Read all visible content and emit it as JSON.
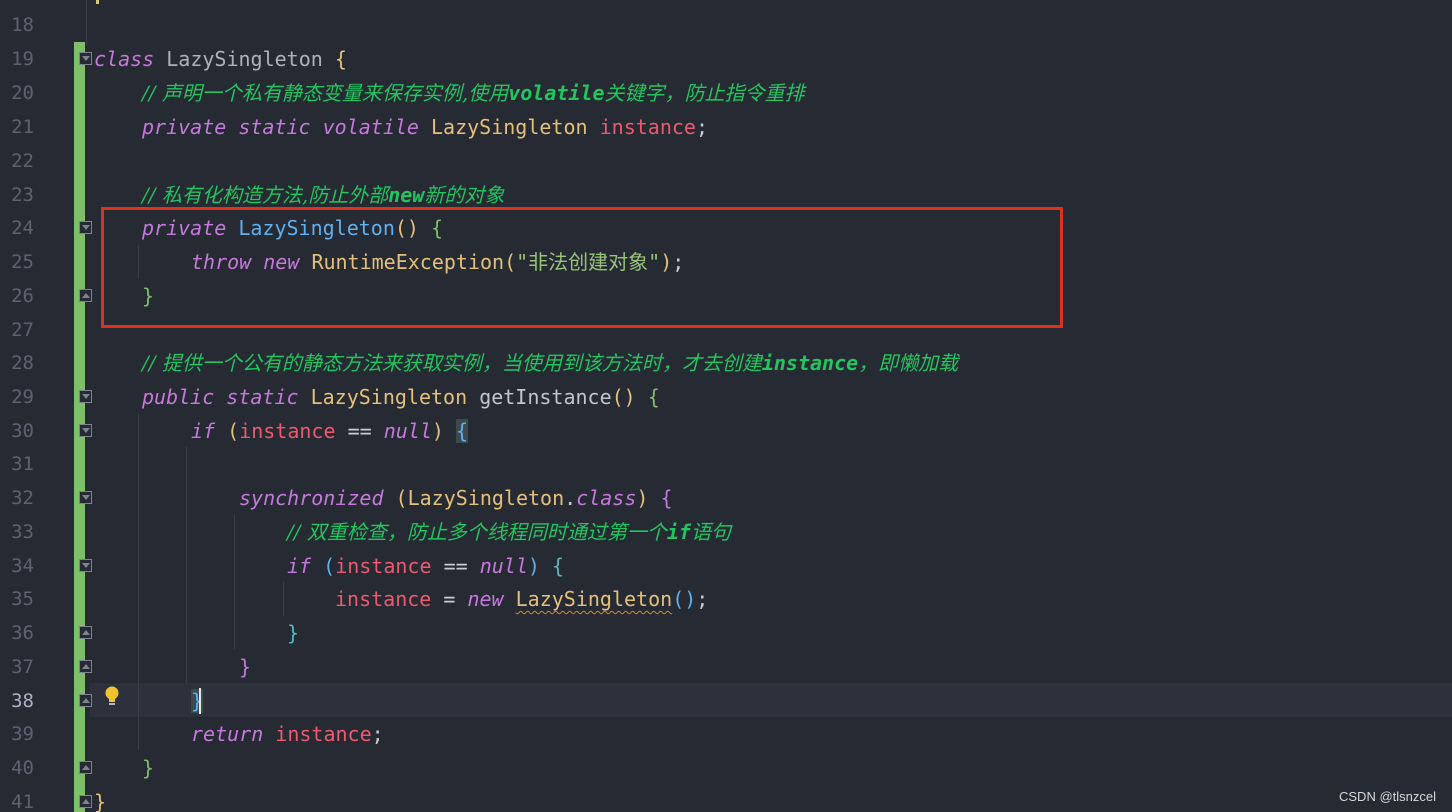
{
  "editor": {
    "language": "java",
    "current_line": 38,
    "watermark": "CSDN @tlsnzcel"
  },
  "line_numbers": [
    "18",
    "19",
    "20",
    "21",
    "22",
    "23",
    "24",
    "25",
    "26",
    "27",
    "28",
    "29",
    "30",
    "31",
    "32",
    "33",
    "34",
    "35",
    "36",
    "37",
    "38",
    "39",
    "40",
    "41"
  ],
  "code": {
    "l19": {
      "kw": "class",
      "name": "LazySingleton",
      "brace": "{"
    },
    "l20": {
      "slashes": "//",
      "t1": "声明一个私有静态变量来保存实例,使用",
      "b1": "volatile",
      "t2": "关键字，防止指令重排"
    },
    "l21": {
      "k1": "private",
      "k2": "static",
      "k3": "volatile",
      "type": "LazySingleton",
      "field": "instance",
      "end": ";"
    },
    "l23": {
      "slashes": "//",
      "t1": "私有化构造方法,防止外部",
      "b1": "new",
      "t2": "新的对象"
    },
    "l24": {
      "k1": "private",
      "fn": "LazySingleton",
      "parens": "()",
      "brace": "{"
    },
    "l25": {
      "k1": "throw",
      "k2": "new",
      "type": "RuntimeException",
      "open": "(",
      "str": "\"非法创建对象\"",
      "close": ")",
      "end": ";"
    },
    "l26": {
      "brace": "}"
    },
    "l28": {
      "slashes": "//",
      "t1": "提供一个公有的静态方法来获取实例，当使用到该方法时，才去创建",
      "b1": "instance",
      "t2": "，即懒加载"
    },
    "l29": {
      "k1": "public",
      "k2": "static",
      "type": "LazySingleton",
      "fn": "getInstance",
      "parens": "()",
      "brace": "{"
    },
    "l30": {
      "k1": "if",
      "open": "(",
      "field": "instance",
      "op": "==",
      "k2": "null",
      "close": ")",
      "brace": "{"
    },
    "l32": {
      "k1": "synchronized",
      "open": "(",
      "type": "LazySingleton",
      "dot": ".",
      "k2": "class",
      "close": ")",
      "brace": "{"
    },
    "l33": {
      "slashes": "//",
      "t1": "双重检查，防止多个线程同时通过第一个",
      "b1": "if",
      "t2": "语句"
    },
    "l34": {
      "k1": "if",
      "open": "(",
      "field": "instance",
      "op": "==",
      "k2": "null",
      "close": ")",
      "brace": "{"
    },
    "l35": {
      "field": "instance",
      "op": "=",
      "k1": "new",
      "type": "LazySingleton",
      "parens": "()",
      "end": ";"
    },
    "l36": {
      "brace": "}"
    },
    "l37": {
      "brace": "}"
    },
    "l38": {
      "brace": "}"
    },
    "l39": {
      "k1": "return",
      "field": "instance",
      "end": ";"
    },
    "l40": {
      "brace": "}"
    },
    "l41": {
      "brace": "}"
    }
  },
  "colors": {
    "background": "#262a33",
    "keyword": "#c678dd",
    "type": "#e5c07b",
    "method": "#61afef",
    "field": "#ef596f",
    "string": "#98c379",
    "comment": "#22c55e",
    "change_bar": "#7fbf6a",
    "highlight_box": "#e0301e"
  },
  "icons": {
    "intention": "lightbulb-icon",
    "fold_open": "fold-open-icon",
    "fold_close": "fold-close-icon"
  }
}
